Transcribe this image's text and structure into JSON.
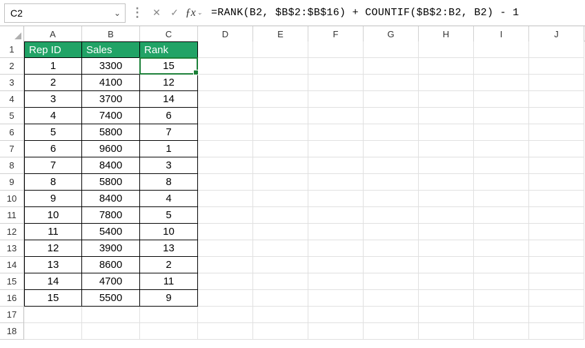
{
  "formula_bar": {
    "cell_ref": "C2",
    "formula": "=RANK(B2, $B$2:$B$16) + COUNTIF($B$2:B2, B2) - 1"
  },
  "columns": [
    "A",
    "B",
    "C",
    "D",
    "E",
    "F",
    "G",
    "H",
    "I",
    "J"
  ],
  "headers": {
    "a": "Rep ID",
    "b": "Sales",
    "c": "Rank"
  },
  "rows": [
    {
      "n": 1
    },
    {
      "n": 2,
      "a": "1",
      "b": "3300",
      "c": "15"
    },
    {
      "n": 3,
      "a": "2",
      "b": "4100",
      "c": "12"
    },
    {
      "n": 4,
      "a": "3",
      "b": "3700",
      "c": "14"
    },
    {
      "n": 5,
      "a": "4",
      "b": "7400",
      "c": "6"
    },
    {
      "n": 6,
      "a": "5",
      "b": "5800",
      "c": "7"
    },
    {
      "n": 7,
      "a": "6",
      "b": "9600",
      "c": "1"
    },
    {
      "n": 8,
      "a": "7",
      "b": "8400",
      "c": "3"
    },
    {
      "n": 9,
      "a": "8",
      "b": "5800",
      "c": "8"
    },
    {
      "n": 10,
      "a": "9",
      "b": "8400",
      "c": "4"
    },
    {
      "n": 11,
      "a": "10",
      "b": "7800",
      "c": "5"
    },
    {
      "n": 12,
      "a": "11",
      "b": "5400",
      "c": "10"
    },
    {
      "n": 13,
      "a": "12",
      "b": "3900",
      "c": "13"
    },
    {
      "n": 14,
      "a": "13",
      "b": "8600",
      "c": "2"
    },
    {
      "n": 15,
      "a": "14",
      "b": "4700",
      "c": "11"
    },
    {
      "n": 16,
      "a": "15",
      "b": "5500",
      "c": "9"
    },
    {
      "n": 17
    },
    {
      "n": 18
    }
  ],
  "selection": {
    "cell": "C2"
  }
}
